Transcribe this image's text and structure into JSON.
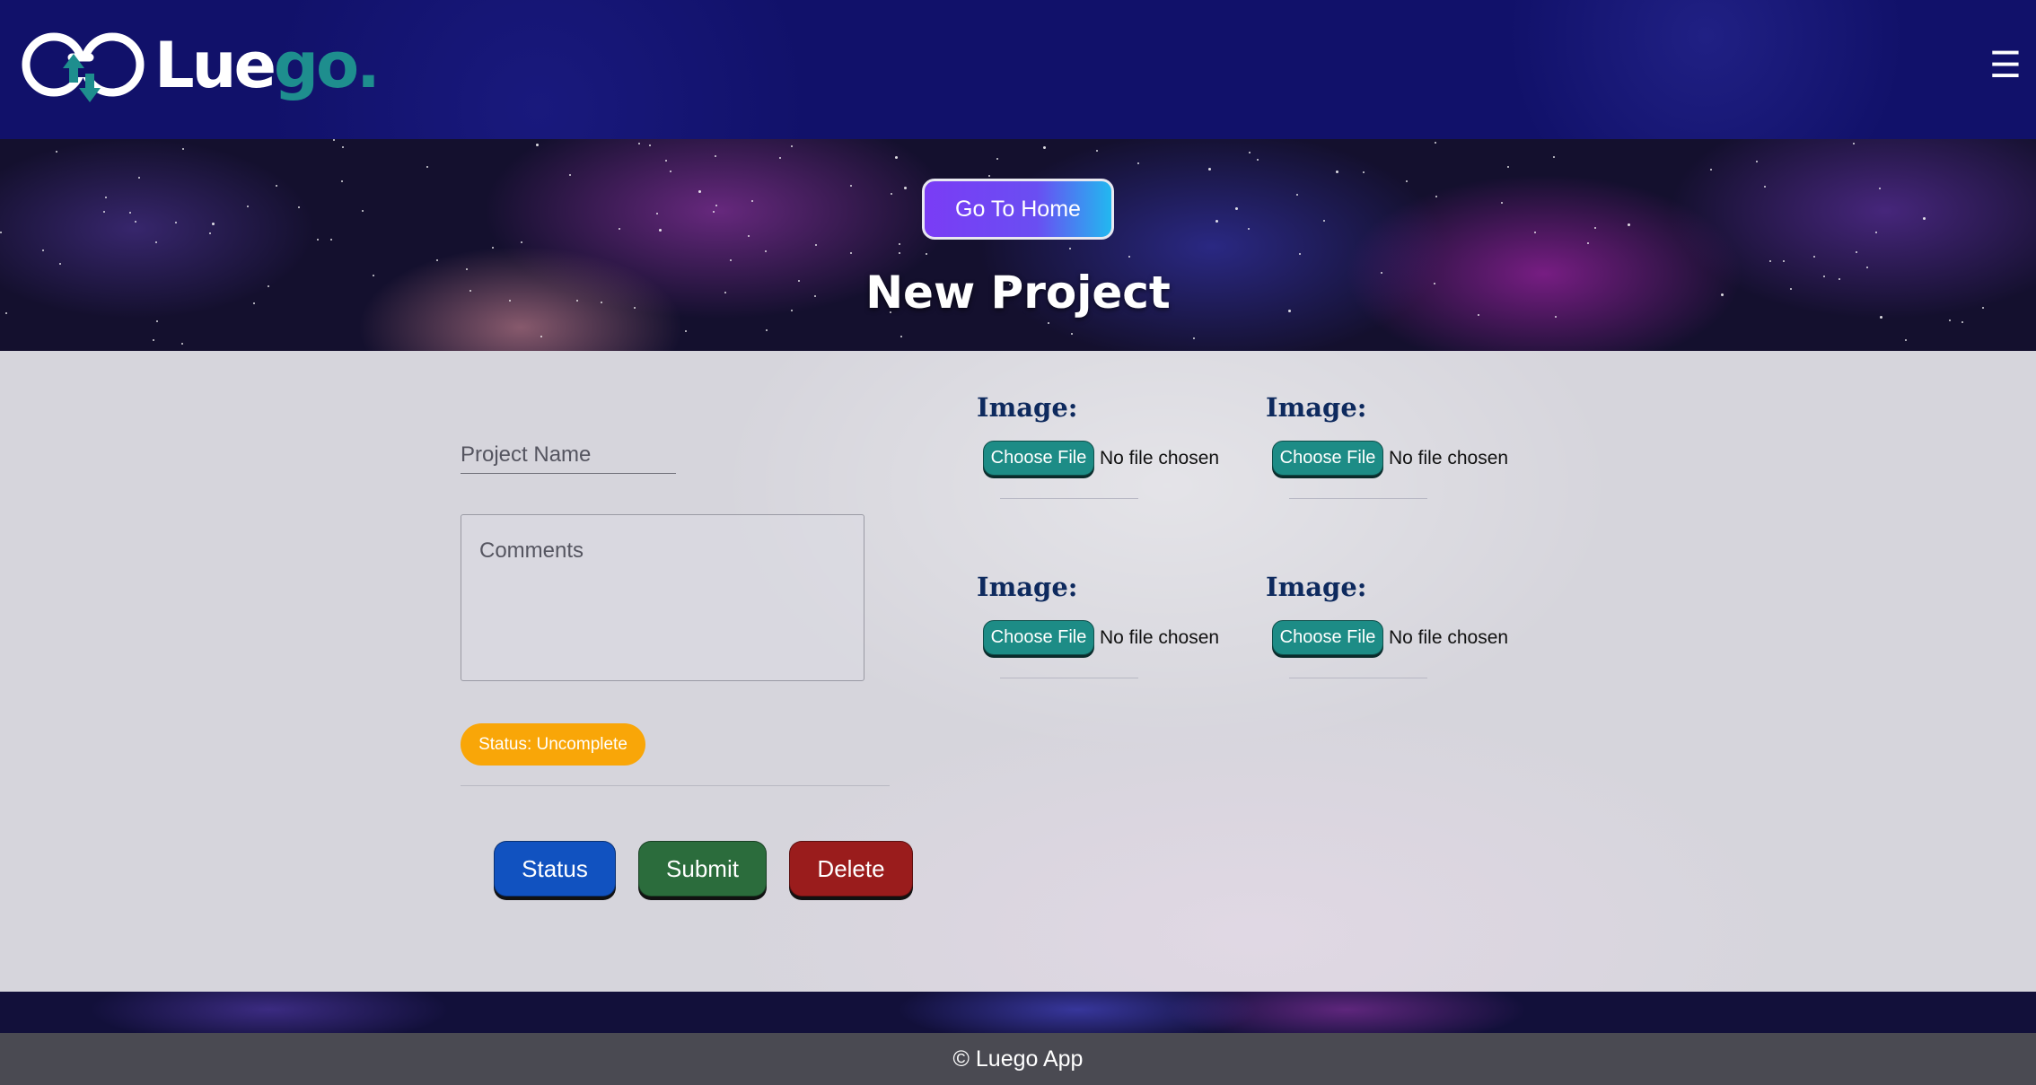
{
  "header": {
    "logo_text_primary": "Lue",
    "logo_text_accent": "go.",
    "menu_icon": "hamburger-menu-icon"
  },
  "banner": {
    "home_button_label": "Go To Home",
    "title": "New Project"
  },
  "form": {
    "project_name_placeholder": "Project Name",
    "comments_placeholder": "Comments",
    "status_badge": "Status: Uncomplete",
    "status_badge_color": "#f9a608",
    "images": [
      {
        "label": "Image:",
        "button": "Choose File",
        "file_status": "No file chosen"
      },
      {
        "label": "Image:",
        "button": "Choose File",
        "file_status": "No file chosen"
      },
      {
        "label": "Image:",
        "button": "Choose File",
        "file_status": "No file chosen"
      },
      {
        "label": "Image:",
        "button": "Choose File",
        "file_status": "No file chosen"
      }
    ],
    "buttons": {
      "status": "Status",
      "submit": "Submit",
      "delete": "Delete"
    },
    "button_colors": {
      "status": "#1152c0",
      "submit": "#2b6c3c",
      "delete": "#9a1c1c"
    }
  },
  "footer": {
    "text": "© Luego App"
  }
}
